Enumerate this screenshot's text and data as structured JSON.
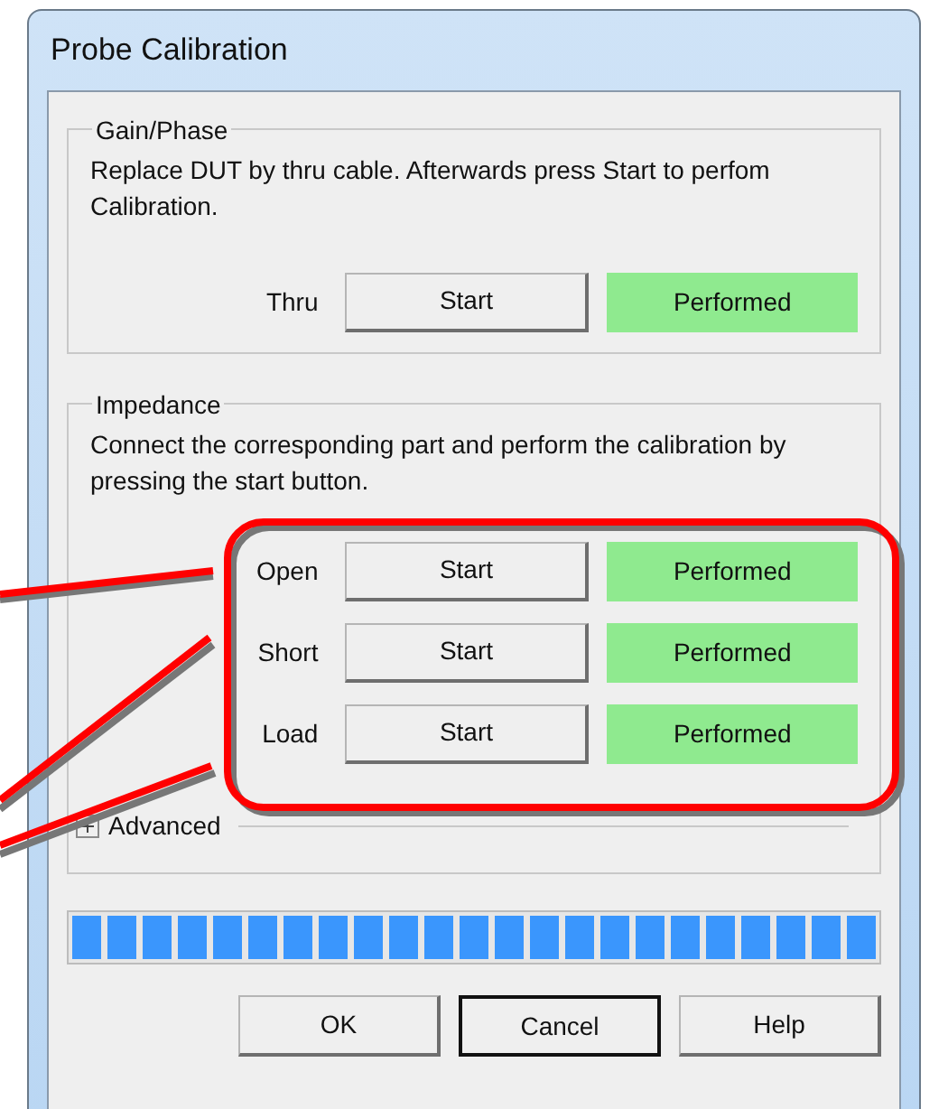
{
  "window": {
    "title": "Probe Calibration"
  },
  "gain_phase": {
    "title": "Gain/Phase",
    "instruction": "Replace DUT by thru cable. Afterwards press Start to perfom Calibration.",
    "rows": [
      {
        "label": "Thru",
        "button": "Start",
        "status": "Performed",
        "performed": true
      }
    ]
  },
  "impedance": {
    "title": "Impedance",
    "instruction": "Connect the corresponding part and perform the calibration by pressing the start button.",
    "rows": [
      {
        "label": "Open",
        "button": "Start",
        "status": "Performed",
        "performed": true
      },
      {
        "label": "Short",
        "button": "Start",
        "status": "Performed",
        "performed": true
      },
      {
        "label": "Load",
        "button": "Start",
        "status": "Performed",
        "performed": true
      }
    ]
  },
  "advanced": {
    "label": "Advanced",
    "expanded": false
  },
  "progress": {
    "level": 1
  },
  "buttons": [
    {
      "label": "OK",
      "focused": false
    },
    {
      "label": "Cancel",
      "focused": true
    },
    {
      "label": "Help",
      "focused": false
    }
  ]
}
